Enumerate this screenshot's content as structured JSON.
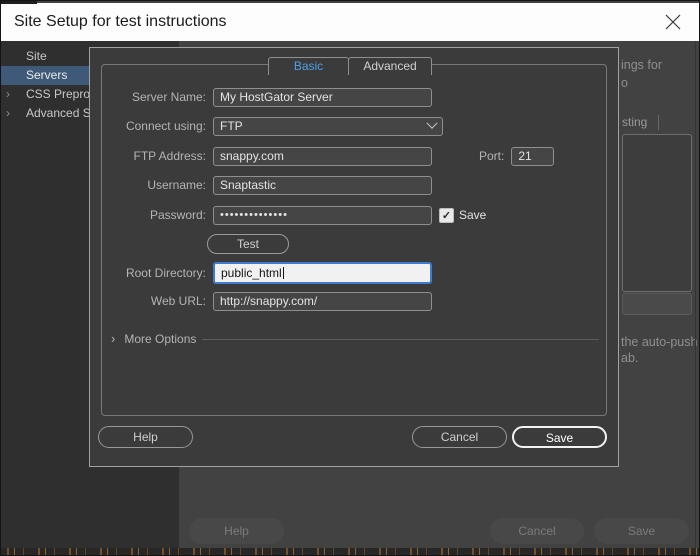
{
  "window": {
    "title": "Site Setup for test instructions"
  },
  "sidebar": {
    "items": [
      {
        "label": "Site",
        "selected": false,
        "chevron": ""
      },
      {
        "label": "Servers",
        "selected": true,
        "chevron": ""
      },
      {
        "label": "CSS Prepro",
        "selected": false,
        "chevron": "›"
      },
      {
        "label": "Advanced S",
        "selected": false,
        "chevron": "›"
      }
    ]
  },
  "server_dialog": {
    "tabs": [
      {
        "label": "Basic"
      },
      {
        "label": "Advanced"
      }
    ],
    "fields": {
      "server_name": {
        "label": "Server Name:",
        "value": "My HostGator Server"
      },
      "connect_using": {
        "label": "Connect using:",
        "value": "FTP"
      },
      "ftp_address": {
        "label": "FTP Address:",
        "value": "snappy.com"
      },
      "port": {
        "label": "Port:",
        "value": "21"
      },
      "username": {
        "label": "Username:",
        "value": "Snaptastic"
      },
      "password": {
        "label": "Password:",
        "value": "••••••••••••••",
        "save_label": "Save",
        "save_check": "✓"
      },
      "root_directory": {
        "label": "Root Directory:",
        "value": "public_html"
      },
      "web_url": {
        "label": "Web URL:",
        "value": "http://snappy.com/"
      }
    },
    "test_button": "Test",
    "more_options": {
      "chevron": "›",
      "label": "More Options"
    },
    "buttons": {
      "help": "Help",
      "cancel": "Cancel",
      "save": "Save"
    }
  },
  "background": {
    "clipped_text_line1": "ings for",
    "clipped_text_line2": "o",
    "clipped_column_header": "sting",
    "clipped_note_line1": "the auto-push",
    "clipped_note_line2": "ab.",
    "buttons": {
      "help": "Help",
      "cancel": "Cancel",
      "save": "Save"
    }
  },
  "colors": {
    "accent_blue": "#4f9ce8",
    "selection_blue": "#3e5a78",
    "focus_border": "#3e7cd0",
    "titlebar_bg": "#fdfdfd",
    "dialog_bg": "#3b3b3b"
  }
}
